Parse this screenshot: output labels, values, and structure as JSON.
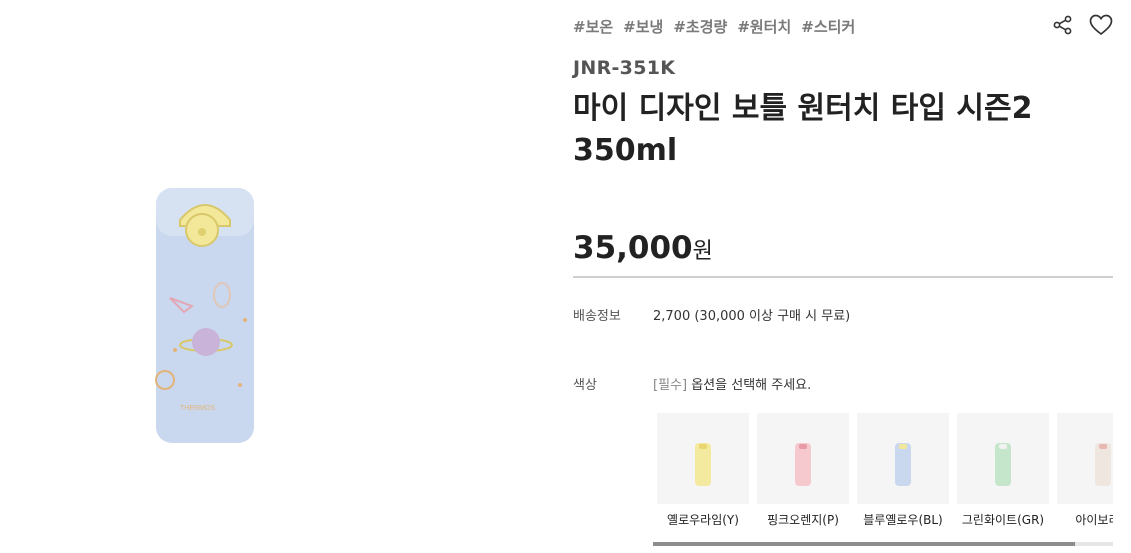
{
  "tags": [
    "#보온",
    "#보냉",
    "#초경량",
    "#원터치",
    "#스티커"
  ],
  "model_code": "JNR-351K",
  "title": "마이 디자인 보틀 원터치 타입 시즌2 350ml",
  "price": {
    "amount": "35,000",
    "unit": "원"
  },
  "shipping": {
    "label": "배송정보",
    "value": "2,700 (30,000 이상 구매 시 무료)"
  },
  "color_option": {
    "label": "색상",
    "required_tag": "[필수]",
    "prompt": "옵션을 선택해 주세요.",
    "options": [
      {
        "label": "옐로우라임(Y)",
        "color": "#f3eaa0"
      },
      {
        "label": "핑크오렌지(P)",
        "color": "#f6c9cf"
      },
      {
        "label": "블루옐로우(BL)",
        "color": "#c9d8ee"
      },
      {
        "label": "그린화이트(GR)",
        "color": "#c6e6cc"
      },
      {
        "label": "아이보리퍼",
        "color": "#efe6e0"
      }
    ]
  },
  "colors": {
    "accent": "#222222",
    "tag_text": "#7a7a7a",
    "bottle": "#c9d8ee"
  },
  "icons": {
    "share": "share-icon",
    "wishlist": "heart-icon"
  }
}
